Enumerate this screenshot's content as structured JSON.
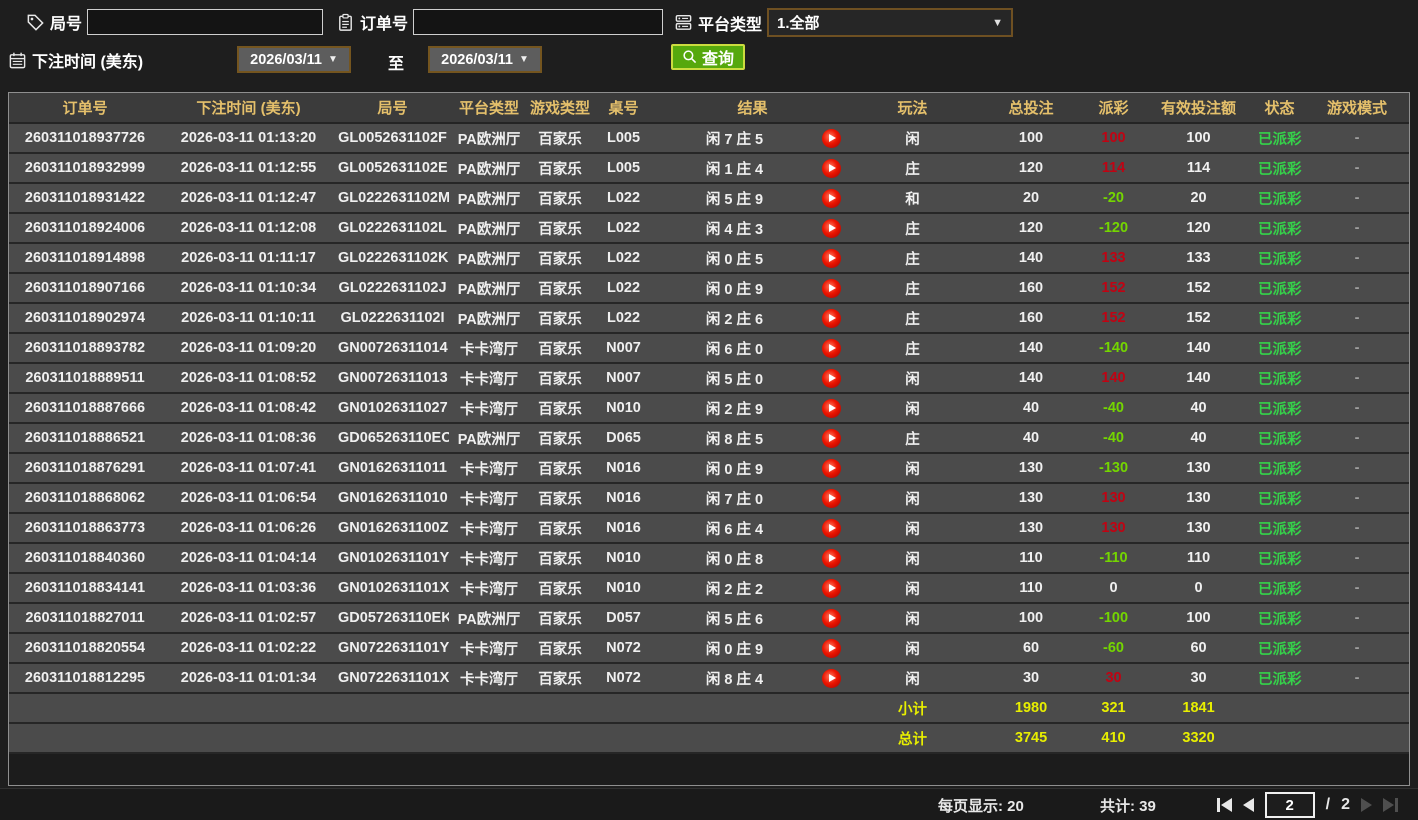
{
  "filters": {
    "round_label": "局号",
    "round_value": "",
    "order_label": "订单号",
    "order_value": "",
    "platform_label": "平台类型",
    "platform_value": "1.全部",
    "time_label": "下注时间 (美东)",
    "date_from": "2026/03/11",
    "to_label": "至",
    "date_to": "2026/03/11",
    "search_label": "查询"
  },
  "icons": {
    "dropdown_arrow": "▼"
  },
  "table": {
    "columns": [
      "订单号",
      "下注时间 (美东)",
      "局号",
      "平台类型",
      "游戏类型",
      "桌号",
      "结果",
      "玩法",
      "总投注",
      "派彩",
      "有效投注额",
      "状态",
      "游戏模式"
    ],
    "rows": [
      {
        "order": "260311018937726",
        "time": "2026-03-11 01:13:20",
        "round": "GL0052631102F",
        "platform": "PA欧洲厅",
        "game": "百家乐",
        "table_no": "L005",
        "result": "闲 7 庄 5",
        "play_type": "闲",
        "bet": "100",
        "payout": "100",
        "payout_class": "win",
        "valid": "100",
        "status": "已派彩",
        "mode": "-"
      },
      {
        "order": "260311018932999",
        "time": "2026-03-11 01:12:55",
        "round": "GL0052631102E",
        "platform": "PA欧洲厅",
        "game": "百家乐",
        "table_no": "L005",
        "result": "闲 1 庄 4",
        "play_type": "庄",
        "bet": "120",
        "payout": "114",
        "payout_class": "win",
        "valid": "114",
        "status": "已派彩",
        "mode": "-"
      },
      {
        "order": "260311018931422",
        "time": "2026-03-11 01:12:47",
        "round": "GL0222631102M",
        "platform": "PA欧洲厅",
        "game": "百家乐",
        "table_no": "L022",
        "result": "闲 5 庄 9",
        "play_type": "和",
        "bet": "20",
        "payout": "-20",
        "payout_class": "loss",
        "valid": "20",
        "status": "已派彩",
        "mode": "-"
      },
      {
        "order": "260311018924006",
        "time": "2026-03-11 01:12:08",
        "round": "GL0222631102L",
        "platform": "PA欧洲厅",
        "game": "百家乐",
        "table_no": "L022",
        "result": "闲 4 庄 3",
        "play_type": "庄",
        "bet": "120",
        "payout": "-120",
        "payout_class": "loss",
        "valid": "120",
        "status": "已派彩",
        "mode": "-"
      },
      {
        "order": "260311018914898",
        "time": "2026-03-11 01:11:17",
        "round": "GL0222631102K",
        "platform": "PA欧洲厅",
        "game": "百家乐",
        "table_no": "L022",
        "result": "闲 0 庄 5",
        "play_type": "庄",
        "bet": "140",
        "payout": "133",
        "payout_class": "win",
        "valid": "133",
        "status": "已派彩",
        "mode": "-"
      },
      {
        "order": "260311018907166",
        "time": "2026-03-11 01:10:34",
        "round": "GL0222631102J",
        "platform": "PA欧洲厅",
        "game": "百家乐",
        "table_no": "L022",
        "result": "闲 0 庄 9",
        "play_type": "庄",
        "bet": "160",
        "payout": "152",
        "payout_class": "win",
        "valid": "152",
        "status": "已派彩",
        "mode": "-"
      },
      {
        "order": "260311018902974",
        "time": "2026-03-11 01:10:11",
        "round": "GL0222631102I",
        "platform": "PA欧洲厅",
        "game": "百家乐",
        "table_no": "L022",
        "result": "闲 2 庄 6",
        "play_type": "庄",
        "bet": "160",
        "payout": "152",
        "payout_class": "win",
        "valid": "152",
        "status": "已派彩",
        "mode": "-"
      },
      {
        "order": "260311018893782",
        "time": "2026-03-11 01:09:20",
        "round": "GN00726311014",
        "platform": "卡卡湾厅",
        "game": "百家乐",
        "table_no": "N007",
        "result": "闲 6 庄 0",
        "play_type": "庄",
        "bet": "140",
        "payout": "-140",
        "payout_class": "loss",
        "valid": "140",
        "status": "已派彩",
        "mode": "-"
      },
      {
        "order": "260311018889511",
        "time": "2026-03-11 01:08:52",
        "round": "GN00726311013",
        "platform": "卡卡湾厅",
        "game": "百家乐",
        "table_no": "N007",
        "result": "闲 5 庄 0",
        "play_type": "闲",
        "bet": "140",
        "payout": "140",
        "payout_class": "win",
        "valid": "140",
        "status": "已派彩",
        "mode": "-"
      },
      {
        "order": "260311018887666",
        "time": "2026-03-11 01:08:42",
        "round": "GN01026311027",
        "platform": "卡卡湾厅",
        "game": "百家乐",
        "table_no": "N010",
        "result": "闲 2 庄 9",
        "play_type": "闲",
        "bet": "40",
        "payout": "-40",
        "payout_class": "loss",
        "valid": "40",
        "status": "已派彩",
        "mode": "-"
      },
      {
        "order": "260311018886521",
        "time": "2026-03-11 01:08:36",
        "round": "GD065263110EC",
        "platform": "PA欧洲厅",
        "game": "百家乐",
        "table_no": "D065",
        "result": "闲 8 庄 5",
        "play_type": "庄",
        "bet": "40",
        "payout": "-40",
        "payout_class": "loss",
        "valid": "40",
        "status": "已派彩",
        "mode": "-"
      },
      {
        "order": "260311018876291",
        "time": "2026-03-11 01:07:41",
        "round": "GN01626311011",
        "platform": "卡卡湾厅",
        "game": "百家乐",
        "table_no": "N016",
        "result": "闲 0 庄 9",
        "play_type": "闲",
        "bet": "130",
        "payout": "-130",
        "payout_class": "loss",
        "valid": "130",
        "status": "已派彩",
        "mode": "-"
      },
      {
        "order": "260311018868062",
        "time": "2026-03-11 01:06:54",
        "round": "GN01626311010",
        "platform": "卡卡湾厅",
        "game": "百家乐",
        "table_no": "N016",
        "result": "闲 7 庄 0",
        "play_type": "闲",
        "bet": "130",
        "payout": "130",
        "payout_class": "win",
        "valid": "130",
        "status": "已派彩",
        "mode": "-"
      },
      {
        "order": "260311018863773",
        "time": "2026-03-11 01:06:26",
        "round": "GN0162631100Z",
        "platform": "卡卡湾厅",
        "game": "百家乐",
        "table_no": "N016",
        "result": "闲 6 庄 4",
        "play_type": "闲",
        "bet": "130",
        "payout": "130",
        "payout_class": "win",
        "valid": "130",
        "status": "已派彩",
        "mode": "-"
      },
      {
        "order": "260311018840360",
        "time": "2026-03-11 01:04:14",
        "round": "GN0102631101Y",
        "platform": "卡卡湾厅",
        "game": "百家乐",
        "table_no": "N010",
        "result": "闲 0 庄 8",
        "play_type": "闲",
        "bet": "110",
        "payout": "-110",
        "payout_class": "loss",
        "valid": "110",
        "status": "已派彩",
        "mode": "-"
      },
      {
        "order": "260311018834141",
        "time": "2026-03-11 01:03:36",
        "round": "GN0102631101X",
        "platform": "卡卡湾厅",
        "game": "百家乐",
        "table_no": "N010",
        "result": "闲 2 庄 2",
        "play_type": "闲",
        "bet": "110",
        "payout": "0",
        "payout_class": "flat",
        "valid": "0",
        "status": "已派彩",
        "mode": "-"
      },
      {
        "order": "260311018827011",
        "time": "2026-03-11 01:02:57",
        "round": "GD057263110EK",
        "platform": "PA欧洲厅",
        "game": "百家乐",
        "table_no": "D057",
        "result": "闲 5 庄 6",
        "play_type": "闲",
        "bet": "100",
        "payout": "-100",
        "payout_class": "loss",
        "valid": "100",
        "status": "已派彩",
        "mode": "-"
      },
      {
        "order": "260311018820554",
        "time": "2026-03-11 01:02:22",
        "round": "GN0722631101Y",
        "platform": "卡卡湾厅",
        "game": "百家乐",
        "table_no": "N072",
        "result": "闲 0 庄 9",
        "play_type": "闲",
        "bet": "60",
        "payout": "-60",
        "payout_class": "loss",
        "valid": "60",
        "status": "已派彩",
        "mode": "-"
      },
      {
        "order": "260311018812295",
        "time": "2026-03-11 01:01:34",
        "round": "GN0722631101X",
        "platform": "卡卡湾厅",
        "game": "百家乐",
        "table_no": "N072",
        "result": "闲 8 庄 4",
        "play_type": "闲",
        "bet": "30",
        "payout": "30",
        "payout_class": "win",
        "valid": "30",
        "status": "已派彩",
        "mode": "-"
      }
    ],
    "subtotal": {
      "label": "小计",
      "bet": "1980",
      "payout": "321",
      "valid": "1841"
    },
    "total": {
      "label": "总计",
      "bet": "3745",
      "payout": "410",
      "valid": "3320"
    }
  },
  "footer": {
    "per_page": "每页显示: 20",
    "total_count": "共计: 39",
    "page": "2",
    "separator": "/",
    "page_count": "2"
  },
  "colors": {
    "page_bg": "#1e1e1e",
    "header_bg": "#3b3b3b",
    "header_text": "#e5c06b",
    "row_bg": "#4b4b4b",
    "win_red": "#c00313",
    "loss_green": "#74d600",
    "status_green": "#35d24a",
    "summary_yellow": "#e8ef00",
    "search_button_green": "#56a80d"
  }
}
